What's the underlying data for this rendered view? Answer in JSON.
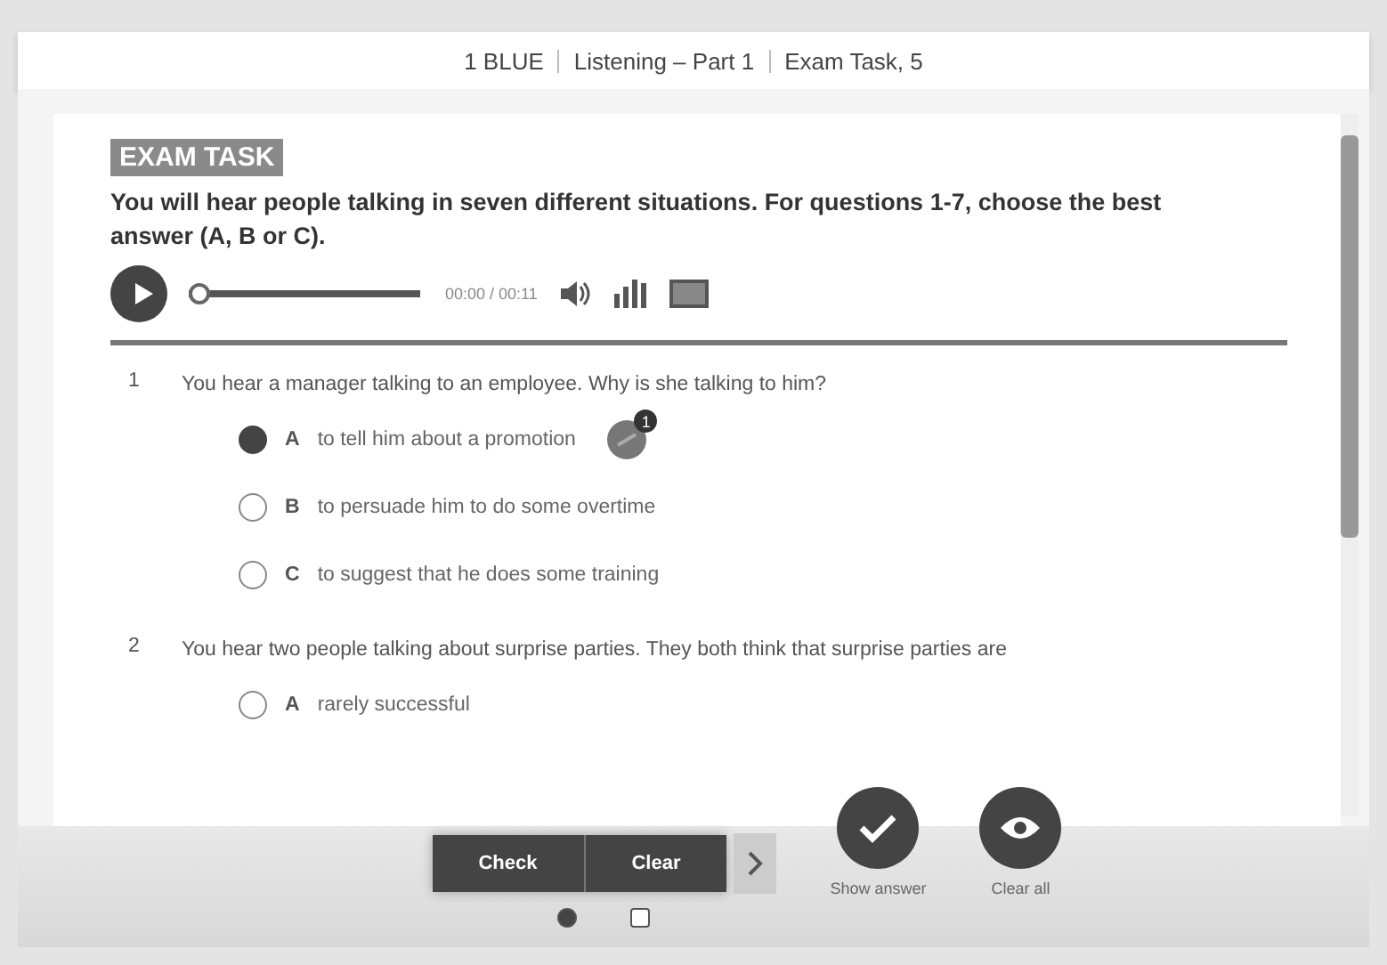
{
  "header": {
    "breadcrumbs": [
      "1 BLUE",
      "Listening – Part 1",
      "Exam Task, 5"
    ]
  },
  "task": {
    "label": "EXAM TASK",
    "instructions": "You will hear people talking in seven different situations. For questions 1-7, choose the best answer (A, B or C).",
    "audio": {
      "level": 0,
      "time": "00:00 / 00:11"
    }
  },
  "questions": [
    {
      "number": "1",
      "text": "You hear a manager talking to an employee. Why is she talking to him?",
      "options": [
        {
          "letter": "A",
          "text": "to tell him about a promotion",
          "selected": true,
          "feedback_badge": "1"
        },
        {
          "letter": "B",
          "text": "to persuade him to do some overtime",
          "selected": false
        },
        {
          "letter": "C",
          "text": "to suggest that he does some training",
          "selected": false
        }
      ]
    },
    {
      "number": "2",
      "text": "You hear two people talking about surprise parties. They both think that surprise parties are",
      "options": [
        {
          "letter": "A",
          "text": "rarely successful",
          "selected": false
        }
      ]
    }
  ],
  "toolbar": {
    "buttons": [
      "Check",
      "Clear"
    ],
    "pages": [
      {
        "selected": true
      },
      {
        "selected": false
      }
    ],
    "actions": [
      {
        "kind": "check",
        "label": "Show answer"
      },
      {
        "kind": "eye",
        "label": "Clear all"
      }
    ]
  }
}
